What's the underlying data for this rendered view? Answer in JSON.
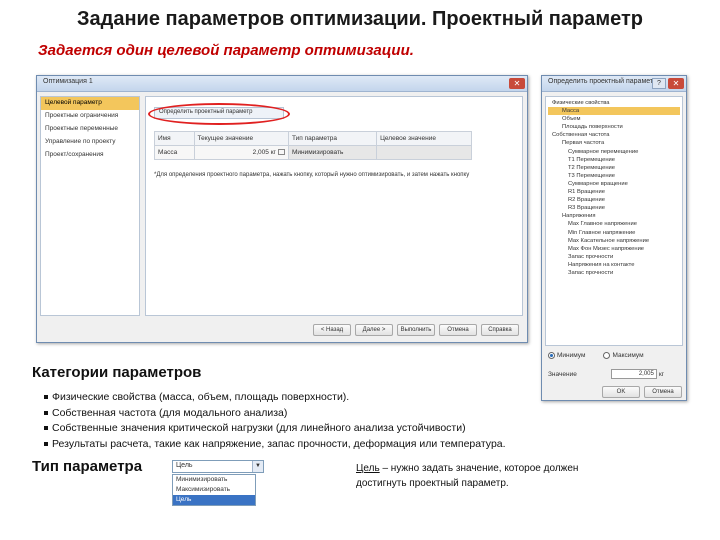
{
  "slide": {
    "title": "Задание параметров оптимизации. Проектный параметр",
    "subtitle": "Задается один целевой параметр оптимизации."
  },
  "main_dialog": {
    "title": "Оптимизация 1",
    "sidebar": [
      "Целевой параметр",
      "Проектные ограничения",
      "Проектные переменные",
      "Управление по проекту",
      "Проект/сохранения"
    ],
    "section_button": "Определить проектный параметр",
    "table": {
      "columns": [
        "Имя",
        "Текущее значение",
        "Тип параметра",
        "Целевое значение"
      ],
      "rows": [
        [
          "Масса",
          "2,005 кг",
          "Минимизировать",
          ""
        ]
      ]
    },
    "note": "*Для определения проектного параметра, нажать кнопку, который нужно оптимизировать, и затем нажать кнопку",
    "buttons": [
      "< Назад",
      "Далее >",
      "Выполнить",
      "Отмена",
      "Справка"
    ]
  },
  "right_dialog": {
    "title": "Определить проектный параметр",
    "tree": [
      "Физические свойства",
      "Масса",
      "Объем",
      "Площадь поверхности",
      "Собственная частота",
      "Первая частота",
      "Суммарное перемещение",
      "T1 Перемещение",
      "T2 Перемещение",
      "T3 Перемещение",
      "Суммарное вращение",
      "R1 Вращение",
      "R2 Вращение",
      "R3 Вращение",
      "Напряжения",
      "Max Главное напряжение",
      "Min Главное напряжение",
      "Max Касательное напряжение",
      "Max Фон Мизес напряжение",
      "Запас прочности",
      "Напряжения на контакте",
      "Запас прочности"
    ],
    "selected_index": 1,
    "radio_minimize": "Минимум",
    "radio_maximize": "Максимум",
    "value_label": "Значение",
    "value": "2,005",
    "value_unit": "кг",
    "buttons": [
      "OK",
      "Отмена"
    ]
  },
  "categories": {
    "heading": "Категории параметров",
    "items": [
      "Физические свойства (масса, объем, площадь поверхности).",
      "Собственная частота (для модального анализа)",
      "Собственные значения критической нагрузки (для линейного анализа устойчивости)",
      "Результаты расчета, такие как напряжение, запас прочности, деформация или температура."
    ]
  },
  "param_type": {
    "heading": "Тип параметра",
    "dropdown_value": "Цель",
    "options": [
      "Минимизировать",
      "Максимизировать",
      "Цель"
    ],
    "highlighted_index": 2,
    "goal_word": "Цель",
    "goal_text": " – нужно задать значение, которое должен достигнуть проектный параметр."
  }
}
